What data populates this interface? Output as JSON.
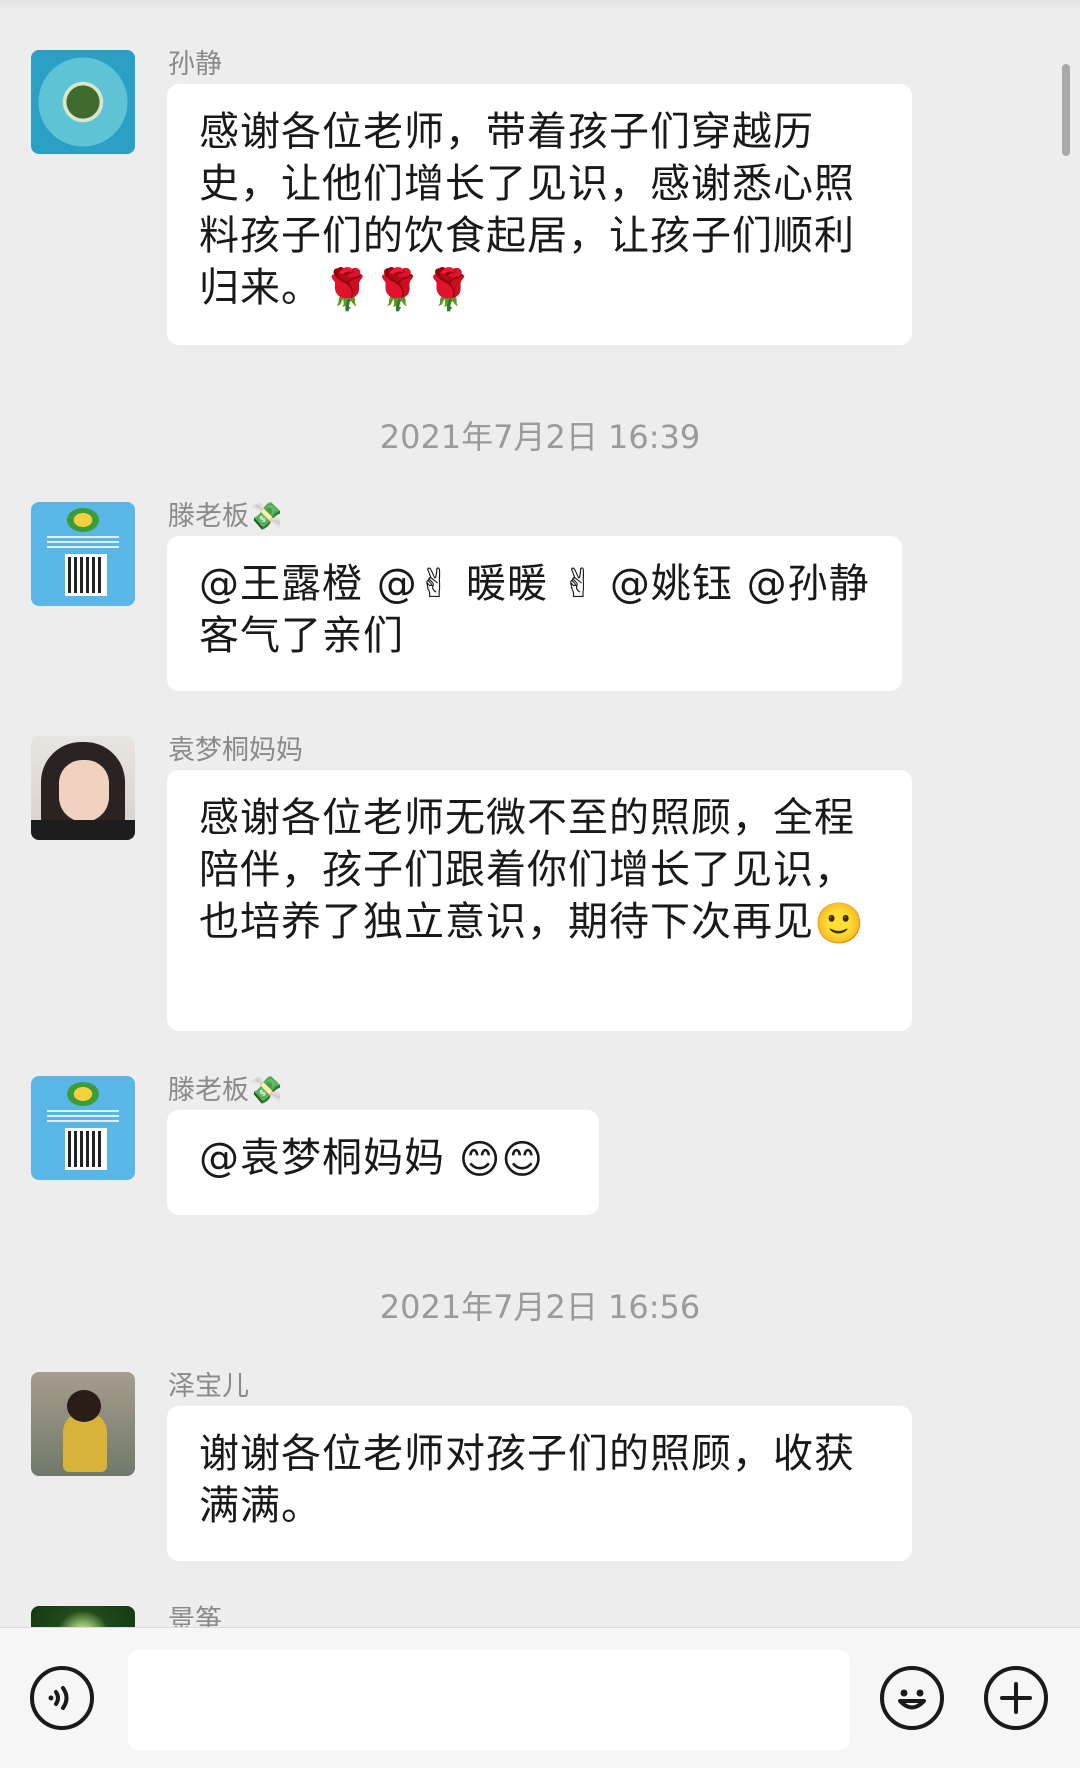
{
  "messages": [
    {
      "sender": "孙静",
      "text": "感谢各位老师，带着孩子们穿越历史，让他们增长了见识，感谢悉心照料孩子们的饮食起居，让孩子们顺利归来。",
      "emoji": "🌹🌹🌹"
    },
    {
      "sender": "滕老板💸",
      "text": "@王露橙 @✌ 暖暖 ✌ @姚钰 @孙静 客气了亲们"
    },
    {
      "sender": "袁梦桐妈妈",
      "text": "感谢各位老师无微不至的照顾，全程陪伴，孩子们跟着你们增长了见识，也培养了独立意识，期待下次再见",
      "emoji": "🙂"
    },
    {
      "sender": "滕老板💸",
      "text": "@袁梦桐妈妈 ",
      "emoji": "😊😊"
    },
    {
      "sender": "泽宝儿",
      "text": "谢谢各位老师对孩子们的照顾，收获满满。"
    },
    {
      "sender": "景筝"
    }
  ],
  "timestamps": [
    "2021年7月2日 16:39",
    "2021年7月2日 16:56"
  ],
  "input_bar": {
    "voice_icon": "voice-icon",
    "emoji_icon": "emoji-icon",
    "plus_icon": "plus-icon",
    "placeholder": ""
  }
}
